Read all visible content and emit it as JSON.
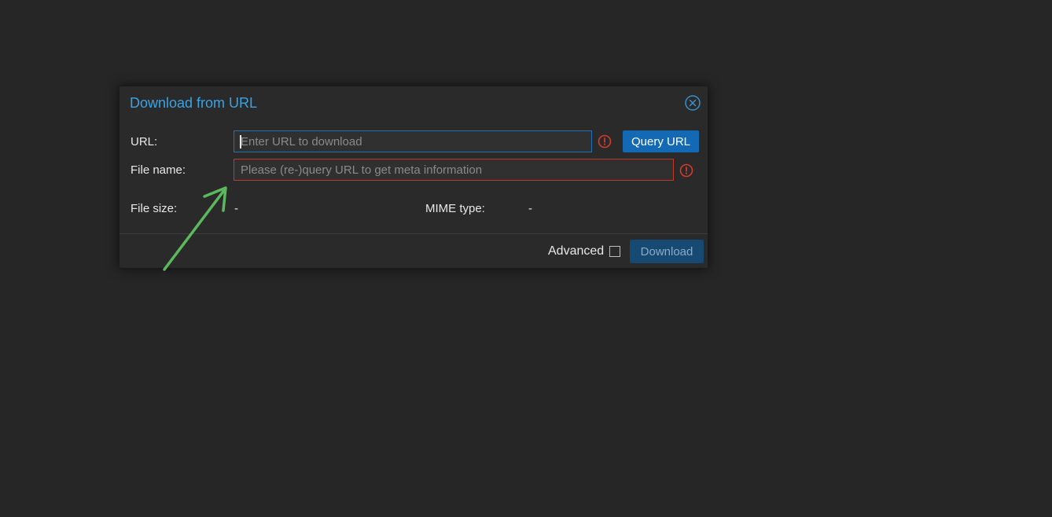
{
  "dialog": {
    "title": "Download from URL",
    "close_icon": "close-circle-icon",
    "url": {
      "label": "URL:",
      "value": "",
      "placeholder": "Enter URL to download",
      "error_icon": "exclamation-circle-icon"
    },
    "query_button_label": "Query URL",
    "file_name": {
      "label": "File name:",
      "value": "",
      "placeholder": "Please (re-)query URL to get meta information",
      "error_icon": "exclamation-circle-icon"
    },
    "file_size": {
      "label": "File size:",
      "value": "-"
    },
    "mime_type": {
      "label": "MIME type:",
      "value": "-"
    },
    "advanced_label": "Advanced",
    "advanced_checked": false,
    "download_button_label": "Download",
    "download_enabled": false
  },
  "colors": {
    "background": "#262626",
    "accent": "#3aa3e3",
    "primary_button": "#1469b5",
    "error": "#c0392b",
    "annotation_arrow": "#5cb85c"
  },
  "annotation": {
    "icon": "arrow-icon"
  }
}
